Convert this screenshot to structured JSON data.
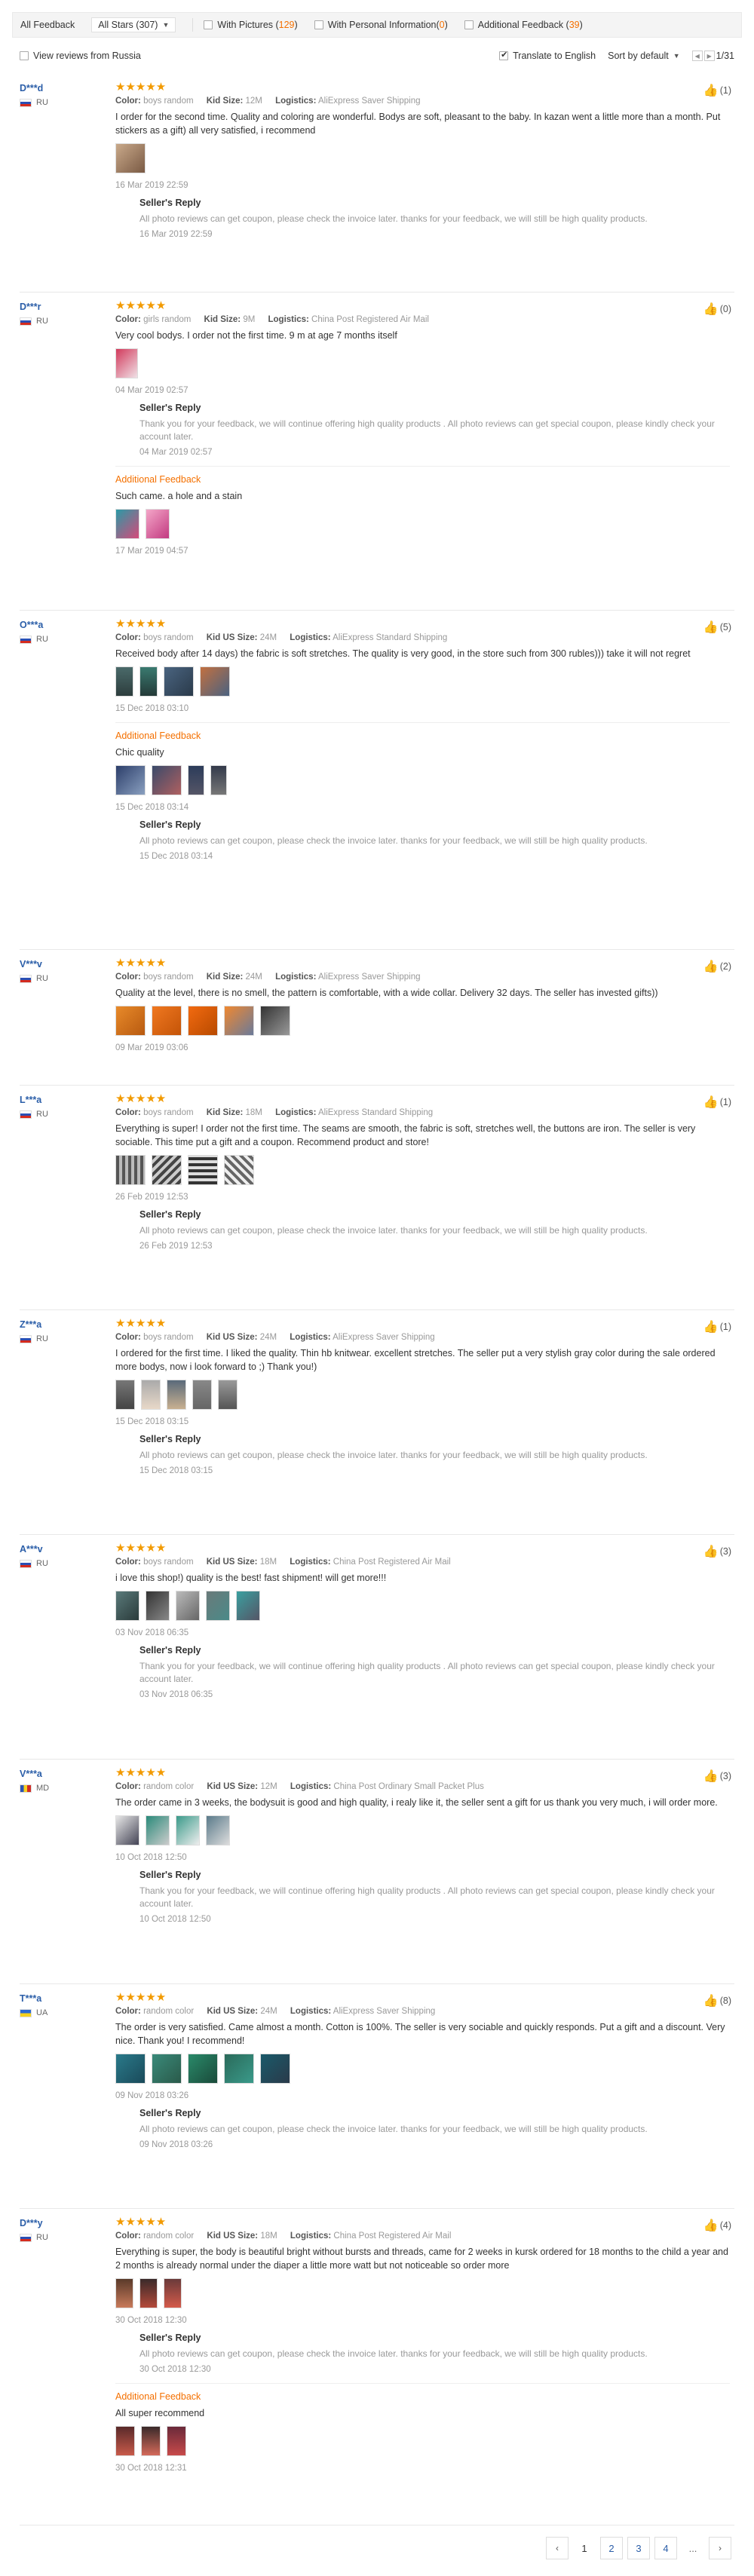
{
  "filters": {
    "all_feedback": "All Feedback",
    "all_stars": "All Stars (307)",
    "with_pictures_label": "With Pictures (",
    "with_pictures_count": "129",
    "with_personal_label": "With Personal Information(",
    "with_personal_count": "0",
    "additional_label": "Additional Feedback (",
    "additional_count": "39",
    "close_paren": ")",
    "view_russia": "View reviews from Russia",
    "translate": "Translate to English",
    "sort": "Sort by default",
    "page_indicator": "1/31"
  },
  "labels": {
    "color": "Color:",
    "kid_size": "Kid Size:",
    "kid_us_size": "Kid US Size:",
    "logistics": "Logistics:",
    "seller_reply": "Seller's Reply",
    "additional_feedback": "Additional Feedback",
    "stars": "★★★★★"
  },
  "reviews": [
    {
      "user": "D***d",
      "country": "RU",
      "helpful": "(1)",
      "color": "boys random",
      "size": "12M",
      "text": "I order for the second time. Quality and coloring are wonderful. Bodys are soft, pleasant to the baby. In kazan went a little more than a month. Put stickers as a gift) all very satisfied, i recommend",
      "date": "16 Mar 2019 22:59",
      "reply": "All photo reviews can get coupon, please check the invoice later. thanks for your feedback, we will still be high quality products.",
      "reply_date": "16 Mar 2019 22:59"
    },
    {
      "user": "D***r",
      "country": "RU",
      "helpful": "(0)",
      "color": "girls random",
      "size": "9M",
      "logistics": "China Post Registered Air Mail",
      "text": "Very cool bodys. I order not the first time. 9 m at age 7 months itself",
      "date": "04 Mar 2019 02:57",
      "reply": "Thank you for your feedback, we will continue offering high quality products . All photo reviews can get special coupon, please kindly check your account later.",
      "reply_date": "04 Mar 2019 02:57",
      "add_text": "Such came. a hole and a stain",
      "add_date": "17 Mar 2019 04:57"
    },
    {
      "user": "O***a",
      "country": "RU",
      "helpful": "(5)",
      "color": "boys random",
      "size": "24M",
      "logistics": "AliExpress Standard Shipping",
      "text": "Received body after 14 days) the fabric is soft stretches. The quality is very good, in the store such from 300 rubles))) take it will not regret",
      "date": "15 Dec 2018 03:10",
      "add_text": "Chic quality",
      "add_date": "15 Dec 2018 03:14",
      "reply": "All photo reviews can get coupon, please check the invoice later. thanks for your feedback, we will still be high quality products.",
      "reply_date": "15 Dec 2018 03:14"
    },
    {
      "user": "V***v",
      "country": "RU",
      "helpful": "(2)",
      "color": "boys random",
      "size": "24M",
      "logistics": "AliExpress Saver Shipping",
      "text": "Quality at the level, there is no smell, the pattern is comfortable, with a wide collar. Delivery 32 days. The seller has invested gifts))",
      "date": "09 Mar 2019 03:06"
    },
    {
      "user": "L***a",
      "country": "RU",
      "helpful": "(1)",
      "color": "boys random",
      "size": "18M",
      "logistics": "AliExpress Standard Shipping",
      "text": "Everything is super! I order not the first time. The seams are smooth, the fabric is soft, stretches well, the buttons are iron. The seller is very sociable. This time put a gift and a coupon. Recommend product and store!",
      "date": "26 Feb 2019 12:53",
      "reply": "All photo reviews can get coupon, please check the invoice later. thanks for your feedback, we will still be high quality products.",
      "reply_date": "26 Feb 2019 12:53"
    },
    {
      "user": "Z***a",
      "country": "RU",
      "helpful": "(1)",
      "color": "boys random",
      "size": "24M",
      "logistics": "AliExpress Saver Shipping",
      "text": "I ordered for the first time. I liked the quality. Thin hb knitwear. excellent stretches. The seller put a very stylish gray color during the sale ordered more bodys, now i look forward to ;) Thank you!)",
      "date": "15 Dec 2018 03:15",
      "reply": "All photo reviews can get coupon, please check the invoice later. thanks for your feedback, we will still be high quality products.",
      "reply_date": "15 Dec 2018 03:15"
    },
    {
      "user": "A***v",
      "country": "RU",
      "helpful": "(3)",
      "color": "boys random",
      "size": "18M",
      "logistics": "China Post Registered Air Mail",
      "text": "i love this shop!) quality is the best! fast shipment! will get more!!!",
      "date": "03 Nov 2018 06:35",
      "reply": "Thank you for your feedback, we will continue offering high quality products . All photo reviews can get special coupon, please kindly check your account later.",
      "reply_date": "03 Nov 2018 06:35"
    },
    {
      "user": "V***a",
      "country": "MD",
      "helpful": "(3)",
      "color": "random color",
      "size": "12M",
      "logistics": "China Post Ordinary Small Packet Plus",
      "text": "The order came in 3 weeks, the bodysuit is good and high quality, i realy like it, the seller sent a gift for us thank you very much, i will order more.",
      "date": "10 Oct 2018 12:50",
      "reply": "Thank you for your feedback, we will continue offering high quality products . All photo reviews can get special coupon, please kindly check your account later.",
      "reply_date": "10 Oct 2018 12:50"
    },
    {
      "user": "T***a",
      "country": "UA",
      "helpful": "(8)",
      "color": "random color",
      "size": "24M",
      "logistics": "AliExpress Saver Shipping",
      "text": "The order is very satisfied. Came almost a month. Cotton is 100%. The seller is very sociable and quickly responds. Put a gift and a discount. Very nice. Thank you! I recommend!",
      "date": "09 Nov 2018 03:26",
      "reply": "All photo reviews can get coupon, please check the invoice later. thanks for your feedback, we will still be high quality products.",
      "reply_date": "09 Nov 2018 03:26"
    },
    {
      "user": "D***y",
      "country": "RU",
      "helpful": "(4)",
      "color": "random color",
      "size": "18M",
      "logistics": "China Post Registered Air Mail",
      "text": "Everything is super, the body is beautiful bright without bursts and threads, came for 2 weeks in kursk ordered for 18 months to the child a year and 2 months is already normal under the diaper a little more watt but not noticeable so order more",
      "date": "30 Oct 2018 12:30",
      "reply": "All photo reviews can get coupon, please check the invoice later. thanks for your feedback, we will still be high quality products.",
      "reply_date": "30 Oct 2018 12:30",
      "add_text": "All super recommend",
      "add_date": "30 Oct 2018 12:31"
    }
  ],
  "pagination": {
    "prev": "‹",
    "current": "1",
    "p2": "2",
    "p3": "3",
    "p4": "4",
    "dots": "...",
    "next": "›"
  }
}
